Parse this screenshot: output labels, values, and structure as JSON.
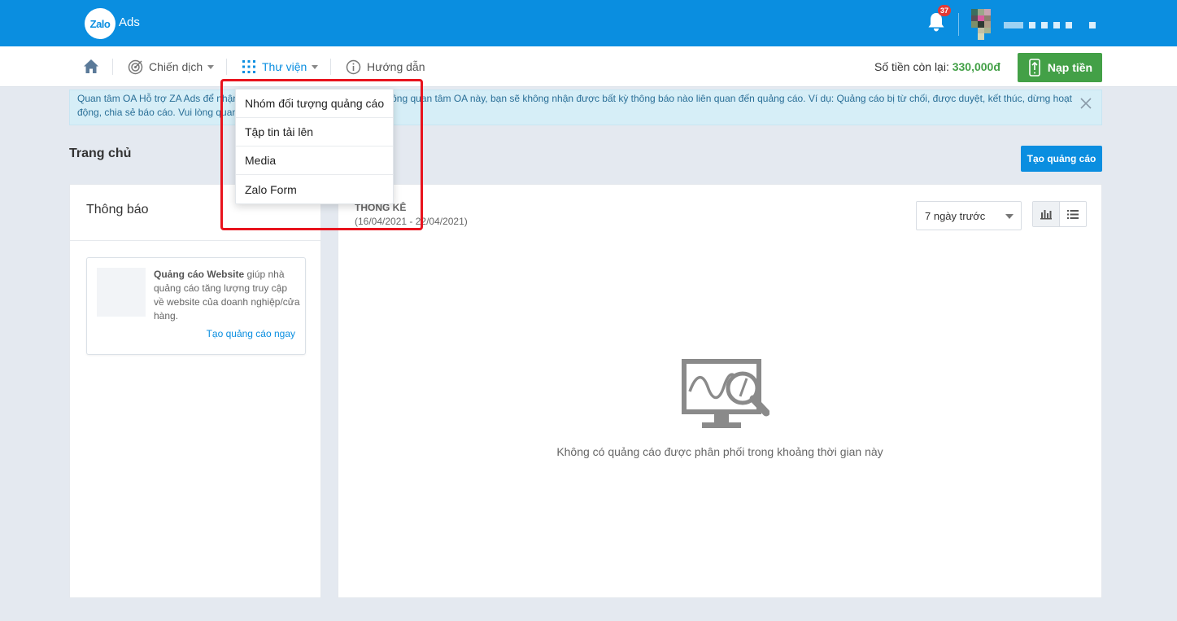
{
  "app": {
    "logo_badge": "Zalo",
    "logo_text": "Ads",
    "notification_count": "37"
  },
  "nav": {
    "items": [
      {
        "label": "Chiến dịch",
        "icon": "target-icon"
      },
      {
        "label": "Thư viện",
        "icon": "grid-icon"
      },
      {
        "label": "Hướng dẫn",
        "icon": "info-icon"
      }
    ],
    "balance_label": "Số tiền còn lại:",
    "balance_value": "330,000đ",
    "topup_label": "Nạp tiền"
  },
  "library_menu": {
    "items": [
      "Nhóm đối tượng quảng cáo",
      "Tập tin tải lên",
      "Media",
      "Zalo Form"
    ]
  },
  "notice": {
    "text_before": "Quan tâm OA Hỗ trợ ZA Ads để nhận",
    "text_after": "hông quan tâm OA này, bạn sẽ không nhận được bất kỳ thông báo nào liên quan đến quảng cáo. Ví dụ: Quảng cáo bị từ chối, được duyệt, kết thúc, dừng hoạt",
    "text_line2": "động, chia sẻ báo cáo. Vui lòng quan"
  },
  "page": {
    "title": "Trang chủ",
    "create_button": "Tạo quảng cáo"
  },
  "notifications_panel": {
    "title": "Thông báo",
    "card": {
      "bold": "Quảng cáo Website",
      "text": " giúp nhà quảng cáo tăng lượng truy cập về website của doanh nghiệp/cửa hàng.",
      "link": "Tạo quảng cáo ngay"
    }
  },
  "stats_panel": {
    "title": "THỐNG KÊ",
    "range": "(16/04/2021 - 22/04/2021)",
    "period": "7 ngày trước",
    "empty_message": "Không có quảng cáo được phân phối trong khoảng thời gian này"
  },
  "colors": {
    "brand_blue": "#0a8ee0",
    "green": "#43a047",
    "highlight_red": "#e8131d"
  }
}
